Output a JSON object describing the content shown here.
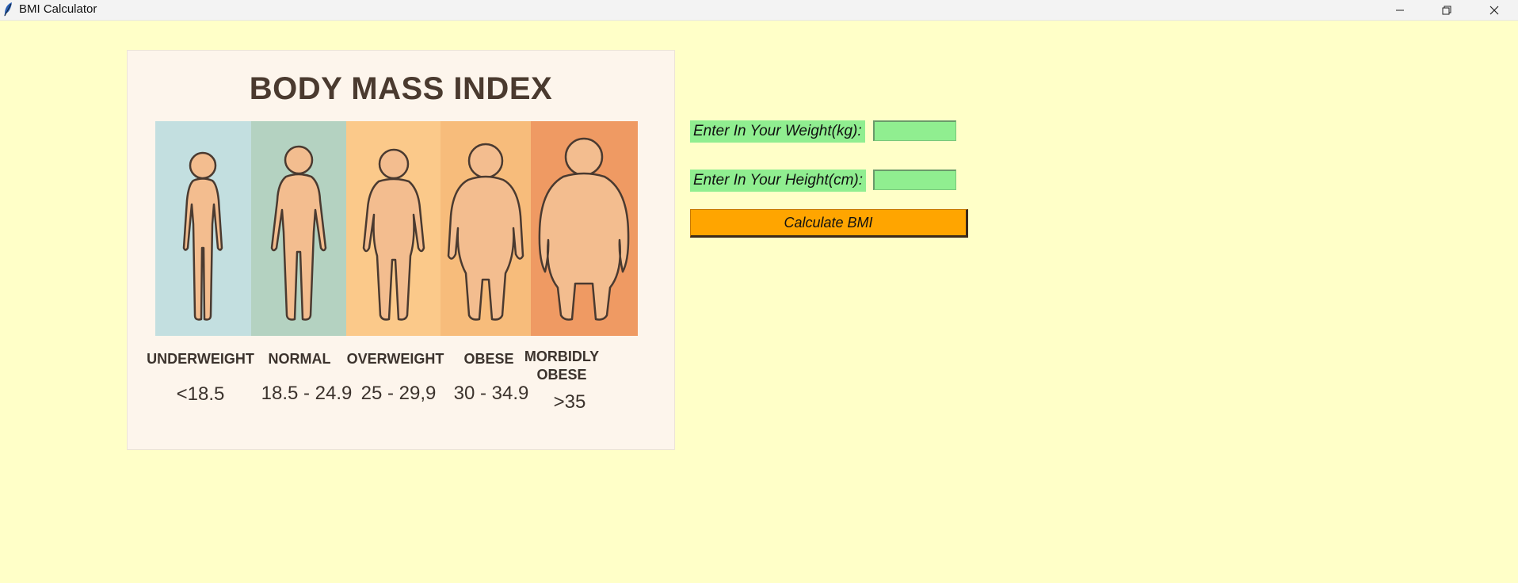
{
  "window": {
    "title": "BMI Calculator"
  },
  "chart": {
    "title": "BODY MASS INDEX",
    "categories": [
      {
        "name": "UNDERWEIGHT",
        "range": "<18.5",
        "color": "#c3dfe0"
      },
      {
        "name": "NORMAL",
        "range": "18.5 - 24.9",
        "color": "#b4d2c1"
      },
      {
        "name": "OVERWEIGHT",
        "range": "25 - 29,9",
        "color": "#fbc98a"
      },
      {
        "name": "OBESE",
        "range": "30 - 34.9",
        "color": "#f7bc7b"
      },
      {
        "name": "MORBIDLY OBESE",
        "range": ">35",
        "color": "#ef9a63"
      }
    ]
  },
  "form": {
    "weight_label": "Enter In Your Weight(kg):",
    "weight_value": "",
    "height_label": "Enter In Your Height(cm):",
    "height_value": "",
    "calculate_label": "Calculate BMI"
  },
  "icons": [
    "feather-icon",
    "minimize-icon",
    "maximize-icon",
    "close-icon"
  ]
}
